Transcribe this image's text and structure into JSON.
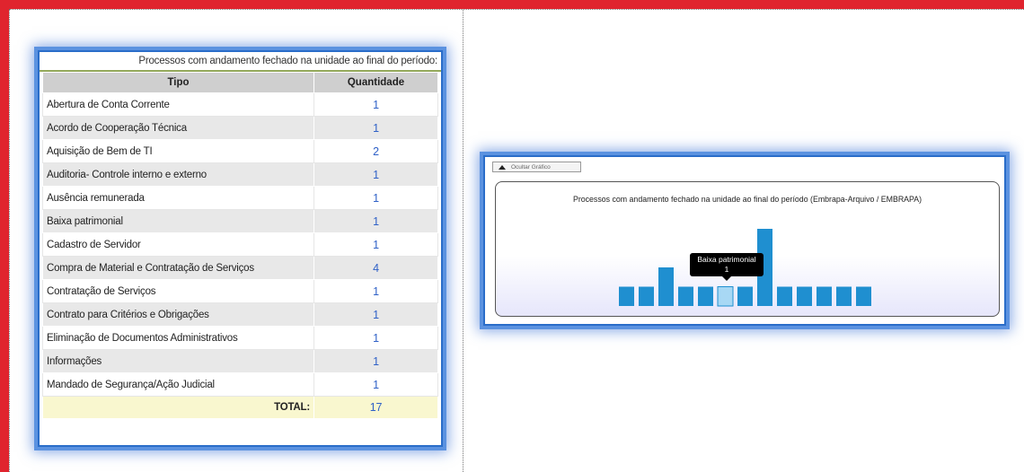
{
  "table": {
    "caption": "Processos com andamento fechado na unidade ao final do período:",
    "header_tipo": "Tipo",
    "header_quantidade": "Quantidade",
    "rows": [
      {
        "tipo": "Abertura de Conta Corrente",
        "quantidade": "1"
      },
      {
        "tipo": "Acordo de Cooperação Técnica",
        "quantidade": "1"
      },
      {
        "tipo": "Aquisição de Bem de TI",
        "quantidade": "2"
      },
      {
        "tipo": "Auditoria- Controle interno e externo",
        "quantidade": "1"
      },
      {
        "tipo": "Ausência remunerada",
        "quantidade": "1"
      },
      {
        "tipo": "Baixa patrimonial",
        "quantidade": "1"
      },
      {
        "tipo": "Cadastro de Servidor",
        "quantidade": "1"
      },
      {
        "tipo": "Compra de Material e Contratação de Serviços",
        "quantidade": "4"
      },
      {
        "tipo": "Contratação de Serviços",
        "quantidade": "1"
      },
      {
        "tipo": "Contrato para Critérios e Obrigações",
        "quantidade": "1"
      },
      {
        "tipo": "Eliminação de Documentos Administrativos",
        "quantidade": "1"
      },
      {
        "tipo": "Informações",
        "quantidade": "1"
      },
      {
        "tipo": "Mandado de Segurança/Ação Judicial",
        "quantidade": "1"
      }
    ],
    "total_label": "TOTAL:",
    "total_value": "17"
  },
  "chart_panel": {
    "hide_button_label": "Ocultar Gráfico",
    "tooltip": {
      "label": "Baixa patrimonial",
      "value": "1"
    }
  },
  "chart_data": {
    "type": "bar",
    "title": "Processos com andamento fechado na unidade ao final do período (Embrapa-Arquivo / EMBRAPA)",
    "categories": [
      "Abertura de Conta Corrente",
      "Acordo de Cooperação Técnica",
      "Aquisição de Bem de TI",
      "Auditoria- Controle interno e externo",
      "Ausência remunerada",
      "Baixa patrimonial",
      "Cadastro de Servidor",
      "Compra de Material e Contratação de Serviços",
      "Contratação de Serviços",
      "Contrato para Critérios e Obrigações",
      "Eliminação de Documentos Administrativos",
      "Informações",
      "Mandado de Segurança/Ação Judicial"
    ],
    "values": [
      1,
      1,
      2,
      1,
      1,
      1,
      1,
      4,
      1,
      1,
      1,
      1,
      1
    ],
    "highlighted_index": 5,
    "ylim": [
      0,
      4
    ],
    "grid": false,
    "bar_color": "#1f8fd0",
    "highlight_color": "#a8d8f4"
  }
}
